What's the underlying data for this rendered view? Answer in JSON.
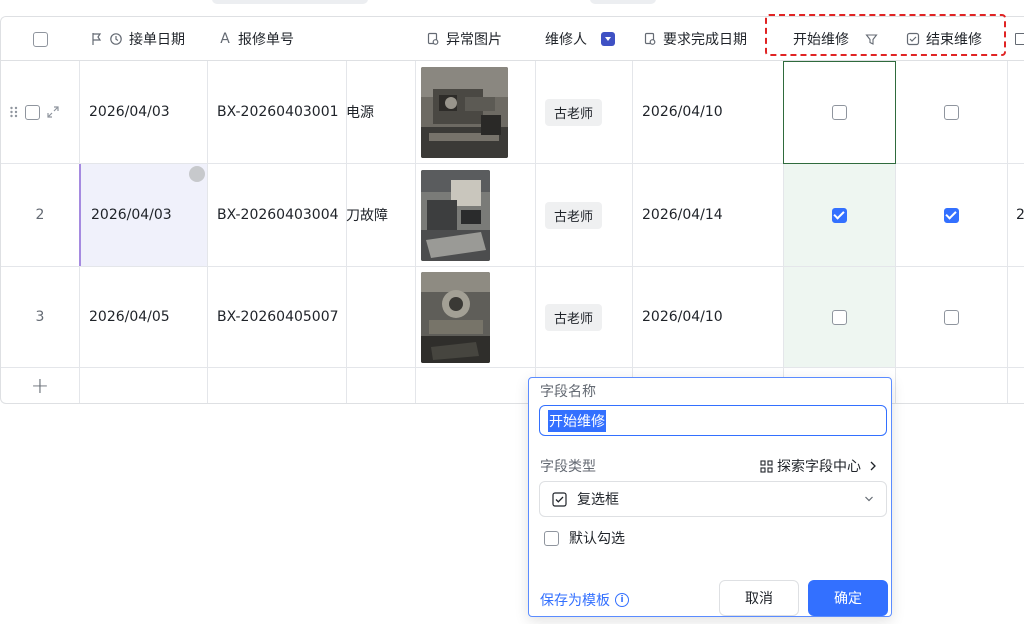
{
  "table": {
    "columns": {
      "receive_date": "接单日期",
      "order_no": "报修单号",
      "abnormal_image": "异常图片",
      "repairer": "维修人",
      "due_date": "要求完成日期",
      "start_repair": "开始维修",
      "end_repair": "结束维修"
    },
    "rows": [
      {
        "num": "",
        "receive_date": "2026/04/03",
        "order_no": "BX-20260403001",
        "fault": "电源",
        "repairer": "古老师",
        "due_date": "2026/04/10",
        "start": false,
        "end": false
      },
      {
        "num": "2",
        "receive_date": "2026/04/03",
        "order_no": "BX-20260403004",
        "fault": "刀故障",
        "repairer": "古老师",
        "due_date": "2026/04/14",
        "start": true,
        "end": true,
        "extra": "2"
      },
      {
        "num": "3",
        "receive_date": "2026/04/05",
        "order_no": "BX-20260405007",
        "fault": "",
        "repairer": "古老师",
        "due_date": "2026/04/10",
        "start": false,
        "end": false
      }
    ],
    "add_row": "+"
  },
  "popup": {
    "field_name_label": "字段名称",
    "field_name_value": "开始维修",
    "field_type_label": "字段类型",
    "explore_link": "探索字段中心",
    "field_type_value": "复选框",
    "default_checked_label": "默认勾选",
    "save_template": "保存为模板",
    "cancel": "取消",
    "confirm": "确定"
  },
  "colors": {
    "accent": "#3370ff",
    "highlight": "#e02424",
    "selected_col": "#eef6f1"
  }
}
